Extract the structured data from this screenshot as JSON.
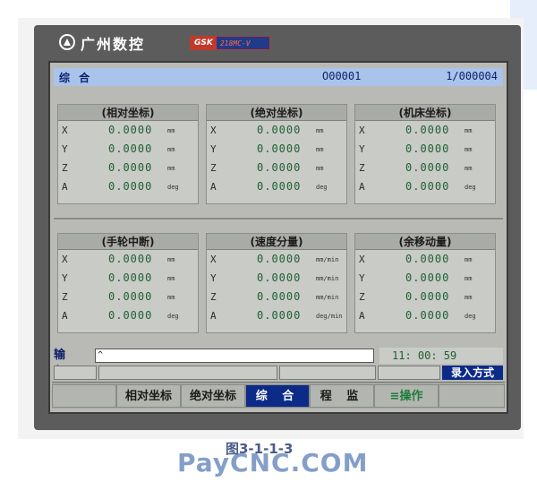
{
  "brand": {
    "name": "广州数控",
    "gsk": "GSK",
    "model": "218MC-V",
    "red_color": "#c0392b",
    "blue_color": "#1f3b8a"
  },
  "title_bar": {
    "mode": "综 合",
    "program": "O00001",
    "page": "1/000004"
  },
  "panels": [
    {
      "title": "(相对坐标)",
      "rows": [
        {
          "axis": "X",
          "value": "0.0000",
          "unit": "mm"
        },
        {
          "axis": "Y",
          "value": "0.0000",
          "unit": "mm"
        },
        {
          "axis": "Z",
          "value": "0.0000",
          "unit": "mm"
        },
        {
          "axis": "A",
          "value": "0.0000",
          "unit": "deg"
        }
      ]
    },
    {
      "title": "(绝对坐标)",
      "rows": [
        {
          "axis": "X",
          "value": "0.0000",
          "unit": "mm"
        },
        {
          "axis": "Y",
          "value": "0.0000",
          "unit": "mm"
        },
        {
          "axis": "Z",
          "value": "0.0000",
          "unit": "mm"
        },
        {
          "axis": "A",
          "value": "0.0000",
          "unit": "deg"
        }
      ]
    },
    {
      "title": "(机床坐标)",
      "rows": [
        {
          "axis": "X",
          "value": "0.0000",
          "unit": "mm"
        },
        {
          "axis": "Y",
          "value": "0.0000",
          "unit": "mm"
        },
        {
          "axis": "Z",
          "value": "0.0000",
          "unit": "mm"
        },
        {
          "axis": "A",
          "value": "0.0000",
          "unit": "deg"
        }
      ]
    },
    {
      "title": "(手轮中断)",
      "rows": [
        {
          "axis": "X",
          "value": "0.0000",
          "unit": "mm"
        },
        {
          "axis": "Y",
          "value": "0.0000",
          "unit": "mm"
        },
        {
          "axis": "Z",
          "value": "0.0000",
          "unit": "mm"
        },
        {
          "axis": "A",
          "value": "0.0000",
          "unit": "deg"
        }
      ]
    },
    {
      "title": "(速度分量)",
      "rows": [
        {
          "axis": "X",
          "value": "0.0000",
          "unit": "mm/min"
        },
        {
          "axis": "Y",
          "value": "0.0000",
          "unit": "mm/min"
        },
        {
          "axis": "Z",
          "value": "0.0000",
          "unit": "mm/min"
        },
        {
          "axis": "A",
          "value": "0.0000",
          "unit": "deg/min"
        }
      ]
    },
    {
      "title": "(余移动量)",
      "rows": [
        {
          "axis": "X",
          "value": "0.0000",
          "unit": "mm"
        },
        {
          "axis": "Y",
          "value": "0.0000",
          "unit": "mm"
        },
        {
          "axis": "Z",
          "value": "0.0000",
          "unit": "mm"
        },
        {
          "axis": "A",
          "value": "0.0000",
          "unit": "deg"
        }
      ]
    }
  ],
  "input": {
    "label": "输 入",
    "value": "^"
  },
  "clock": "11: 00: 59",
  "mode_badge": "录入方式",
  "softkeys": [
    {
      "label": ""
    },
    {
      "label": "相对坐标"
    },
    {
      "label": "绝对坐标"
    },
    {
      "label": "综 合"
    },
    {
      "label": "程 监"
    },
    {
      "label": "≡操作"
    },
    {
      "label": ""
    }
  ],
  "caption": "图3-1-1-3",
  "watermark": "PayCNC.COM",
  "colors": {
    "screen_bg": "#b9bab5",
    "title_bar": "#aac3ea",
    "value_green": "#1f5f34",
    "active_softkey": "#0c2a88"
  }
}
